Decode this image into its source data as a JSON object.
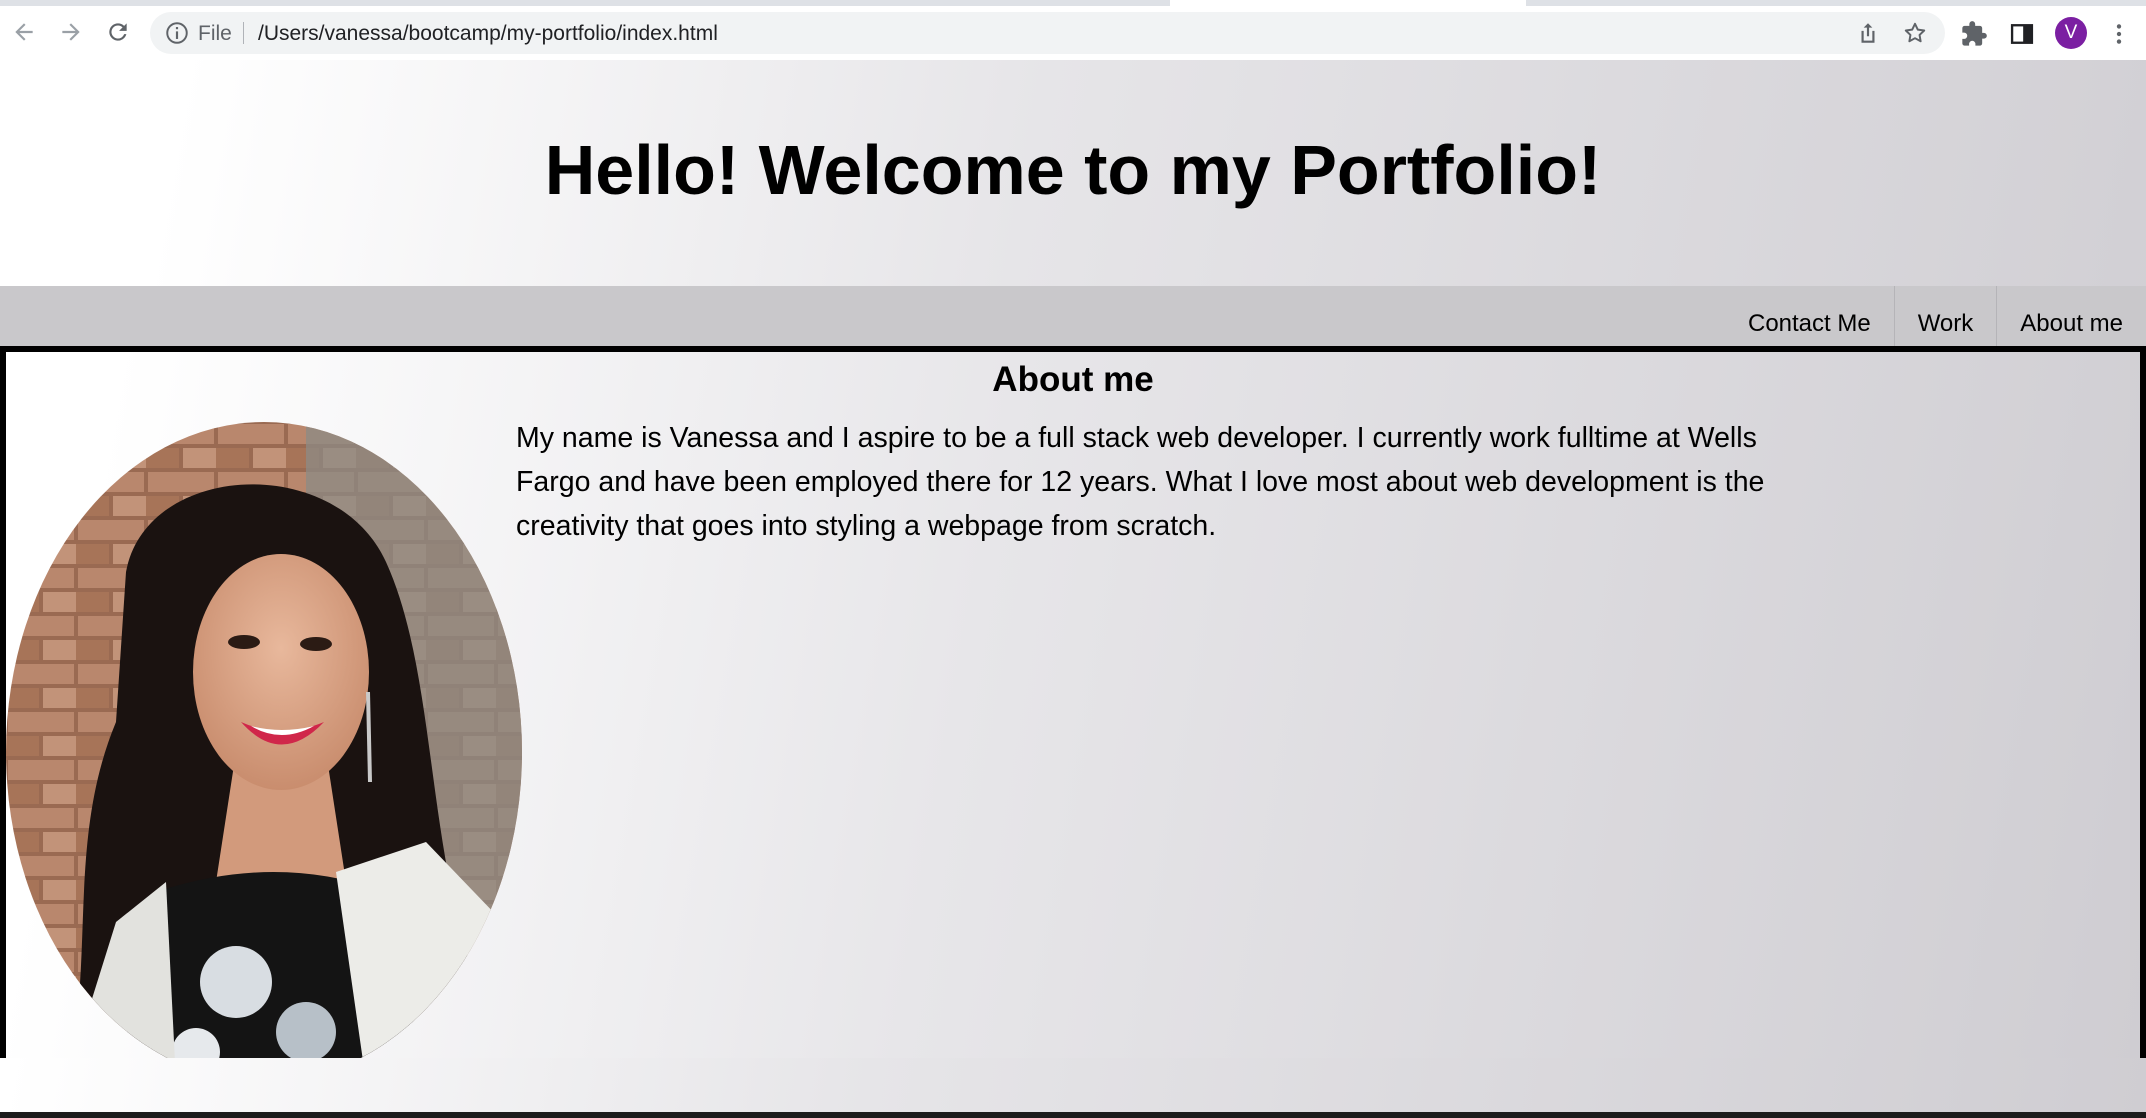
{
  "browser": {
    "back_icon": "arrow-left-icon",
    "forward_icon": "arrow-right-icon",
    "reload_icon": "reload-icon",
    "scheme_label": "File",
    "url": "/Users/vanessa/bootcamp/my-portfolio/index.html",
    "avatar_initial": "V",
    "colors": {
      "avatar": "#7b1fa2",
      "omnibox": "#f1f3f4"
    }
  },
  "page": {
    "title": "Hello! Welcome to my Portfolio!",
    "nav": [
      {
        "label": "Contact Me"
      },
      {
        "label": "Work"
      },
      {
        "label": "About me"
      }
    ],
    "about": {
      "heading": "About me",
      "body": "My name is Vanessa and I aspire to be a full stack web developer. I currently work fulltime at Wells Fargo and have been employed there for 12 years. What I love most about web development is the creativity that goes into styling a webpage from scratch."
    },
    "colors": {
      "navbar": "#c9c8cb",
      "section_border": "#000000"
    }
  }
}
